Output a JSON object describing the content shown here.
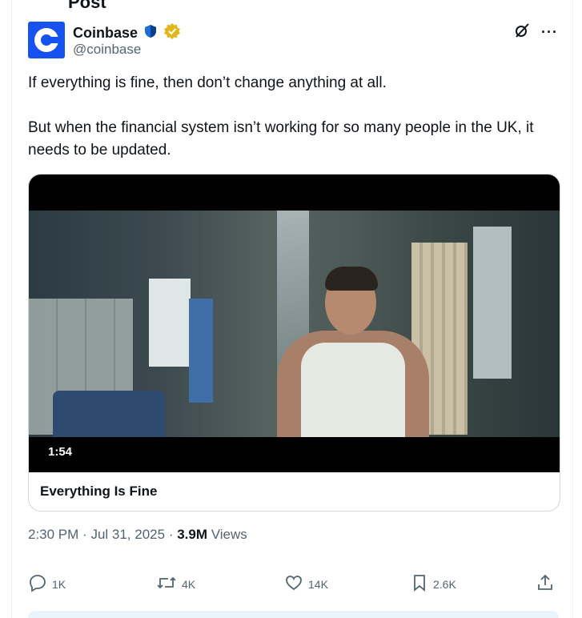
{
  "header": {
    "cut_title": "Post"
  },
  "tweet": {
    "author_name": "Coinbase",
    "handle": "@coinbase",
    "paragraphs": [
      "If everything is fine, then don’t change anything at all.",
      "But when the financial system isn’t working for so many people in the UK, it needs to be updated."
    ]
  },
  "media": {
    "duration": "1:54",
    "title": "Everything Is Fine"
  },
  "meta": {
    "time": "2:30 PM",
    "date": "Jul 31, 2025",
    "views_count": "3.9M",
    "views_label": "Views"
  },
  "actions": {
    "reply_count": "1K",
    "repost_count": "4K",
    "like_count": "14K",
    "bookmark_count": "2.6K"
  },
  "colors": {
    "brand_blue": "#1652f0",
    "muted": "#536471",
    "text": "#0f1419"
  },
  "icons": {
    "badges": [
      "shield-badge-icon",
      "verified-gold-icon"
    ],
    "header": [
      "grok-icon",
      "more-icon"
    ],
    "actions": [
      "reply-icon",
      "repost-icon",
      "like-icon",
      "bookmark-icon",
      "share-icon"
    ]
  }
}
